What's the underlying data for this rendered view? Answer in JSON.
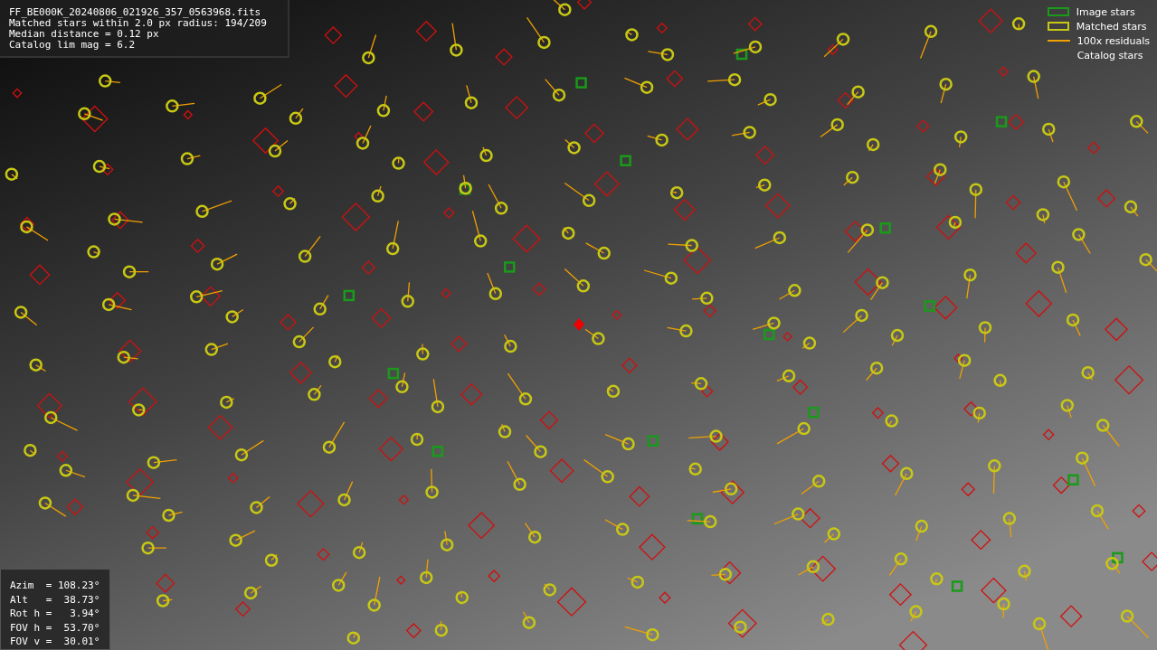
{
  "info_box": {
    "lines": [
      "FF_BE000K_20240806_021926_357_0563968.fits",
      "Matched stars within 2.0 px radius: 194/209",
      "Median distance = 0.12 px",
      "Catalog lim mag = 6.2"
    ]
  },
  "legend": [
    {
      "kind": "box",
      "color": "#1a9a1a",
      "label": "Image stars"
    },
    {
      "kind": "box",
      "color": "#c8c814",
      "label": "Matched stars"
    },
    {
      "kind": "line",
      "color": "#f0a000",
      "label": "100x residuals"
    },
    {
      "kind": "none",
      "label": "Catalog stars"
    }
  ],
  "pointing_box": {
    "lines": [
      "Azim  = 108.23°",
      "Alt   =  38.73°",
      "Rot h =   3.94°",
      "FOV h =  53.70°",
      "FOV v =  30.01°"
    ]
  }
}
